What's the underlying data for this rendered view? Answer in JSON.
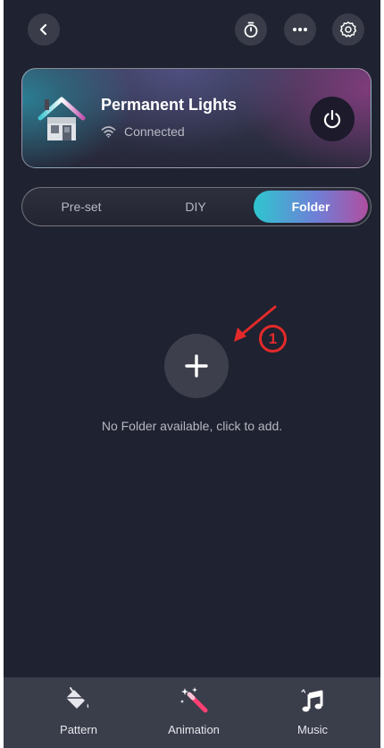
{
  "device": {
    "name": "Permanent Lights",
    "status": "Connected"
  },
  "tabs": [
    {
      "label": "Pre-set",
      "active": false
    },
    {
      "label": "DIY",
      "active": false
    },
    {
      "label": "Folder",
      "active": true
    }
  ],
  "content": {
    "empty_message": "No Folder available, click to add.",
    "annotation_marker": "1"
  },
  "bottom_nav": [
    {
      "label": "Pattern",
      "icon": "paint-bucket-icon"
    },
    {
      "label": "Animation",
      "icon": "magic-wand-icon"
    },
    {
      "label": "Music",
      "icon": "music-note-icon"
    }
  ],
  "colors": {
    "background": "#1f2230",
    "tab_gradient_start": "#2ec6cf",
    "tab_gradient_end": "#b04ea0",
    "annotation_red": "#e32a2a"
  }
}
